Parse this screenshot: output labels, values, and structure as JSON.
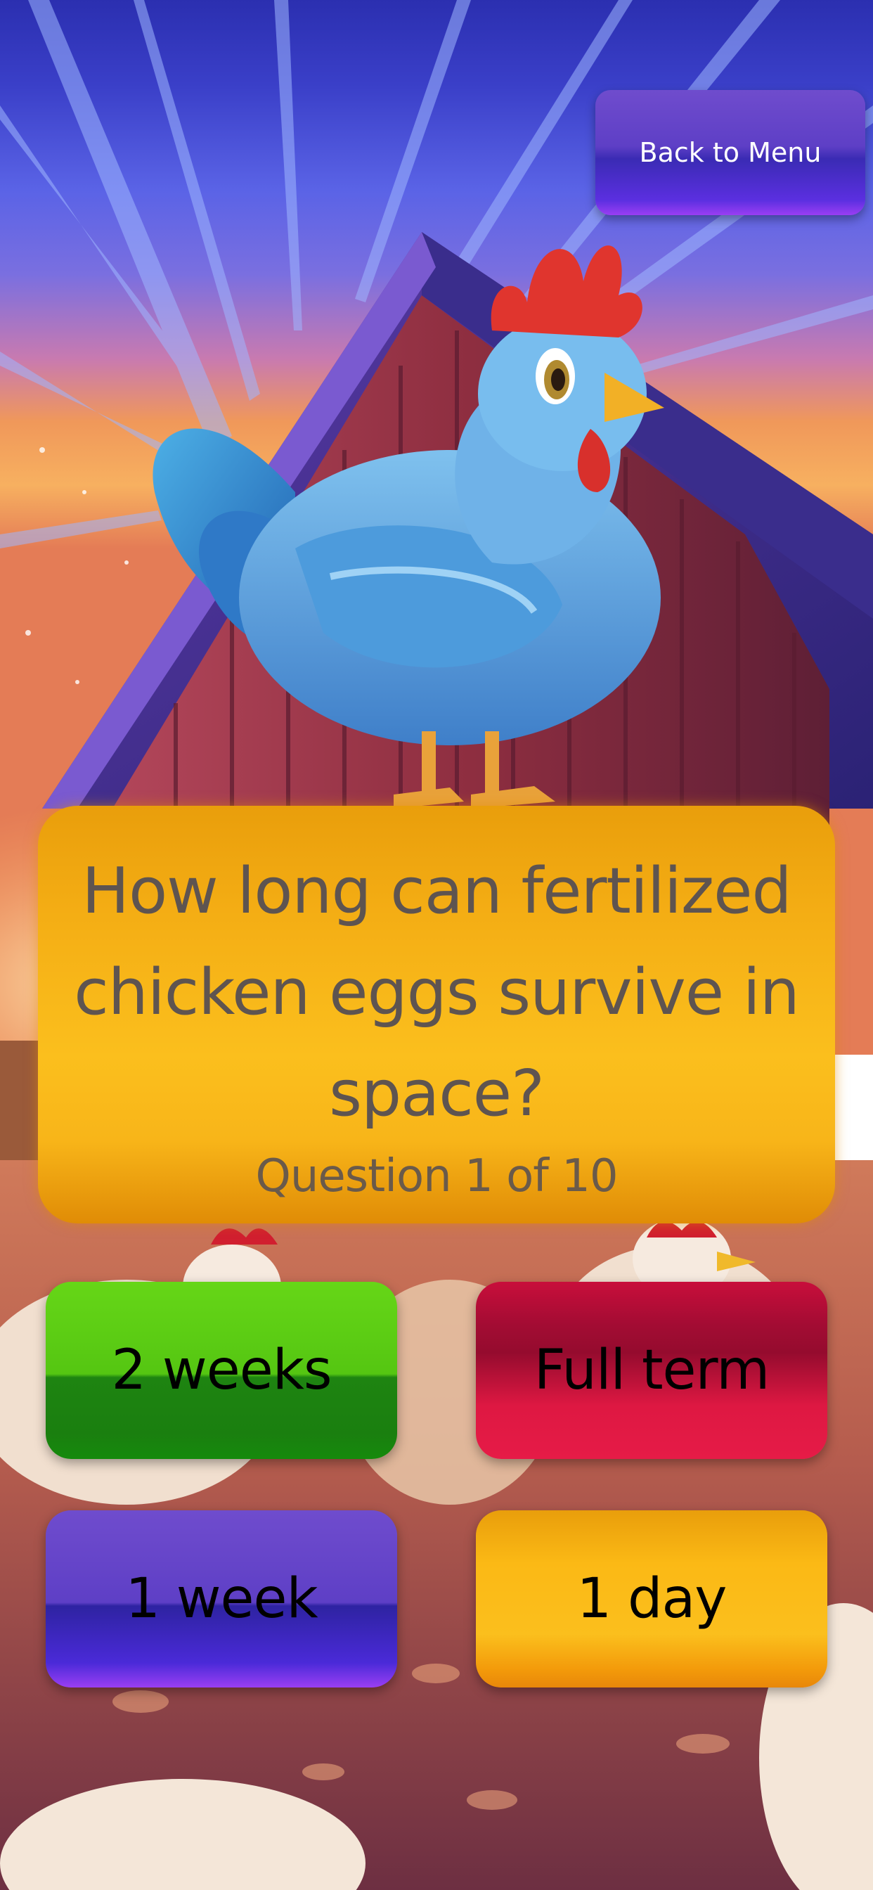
{
  "menu": {
    "back_label": "Back to Menu"
  },
  "question": {
    "text": "How long can fertilized chicken eggs survive in space?",
    "counter": "Question 1 of 10"
  },
  "answers": [
    {
      "label": "2 weeks",
      "color": "#4fbf16"
    },
    {
      "label": "Full term",
      "color": "#d41440"
    },
    {
      "label": "1 week",
      "color": "#5a3bd0"
    },
    {
      "label": "1 day",
      "color": "#f7b51a"
    }
  ],
  "scene": {
    "description_icons": [
      "rooster-illustration",
      "barn-illustration",
      "hen-illustration"
    ],
    "colors": {
      "sky_top": "#2f2bb8",
      "sky_mid": "#5c62e6",
      "sunset": "#f08a3c",
      "barn_red": "#8c2c3c",
      "ground": "#c56a52"
    }
  }
}
